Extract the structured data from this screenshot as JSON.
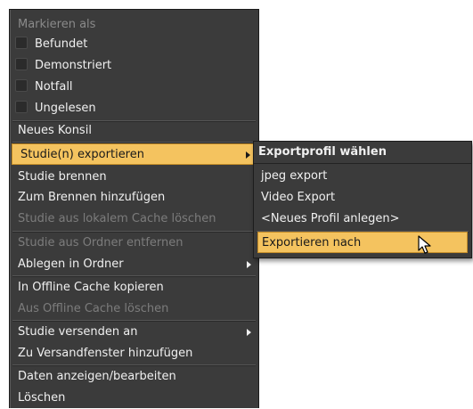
{
  "main_menu": {
    "group_header": "Markieren als",
    "mark_items": [
      "Befundet",
      "Demonstriert",
      "Notfall",
      "Ungelesen"
    ],
    "new_consult": "Neues Konsil",
    "export_studies": "Studie(n) exportieren",
    "burn_study": "Studie brennen",
    "add_to_burning": "Zum Brennen hinzufügen",
    "delete_from_cache": "Studie aus lokalem Cache löschen",
    "remove_from_folder": "Studie aus Ordner entfernen",
    "file_in_folder": "Ablegen in Ordner",
    "copy_to_offline_cache": "In Offline Cache kopieren",
    "delete_from_offline_cache": "Aus Offline Cache löschen",
    "send_study_to": "Studie versenden an",
    "add_to_shipping_window": "Zu Versandfenster hinzufügen",
    "view_edit_data": "Daten anzeigen/bearbeiten",
    "delete": "Löschen"
  },
  "submenu": {
    "title": "Exportprofil wählen",
    "items": [
      "jpeg export",
      "Video Export",
      "<Neues Profil anlegen>"
    ],
    "export_to": "Exportieren nach"
  },
  "colors": {
    "menu_bg": "#3b3b3b",
    "highlight": "#f4c35f",
    "disabled_text": "#7c7c7c"
  },
  "icons": {
    "submenu_arrow": "triangle-right",
    "cursor": "arrow-pointer"
  }
}
